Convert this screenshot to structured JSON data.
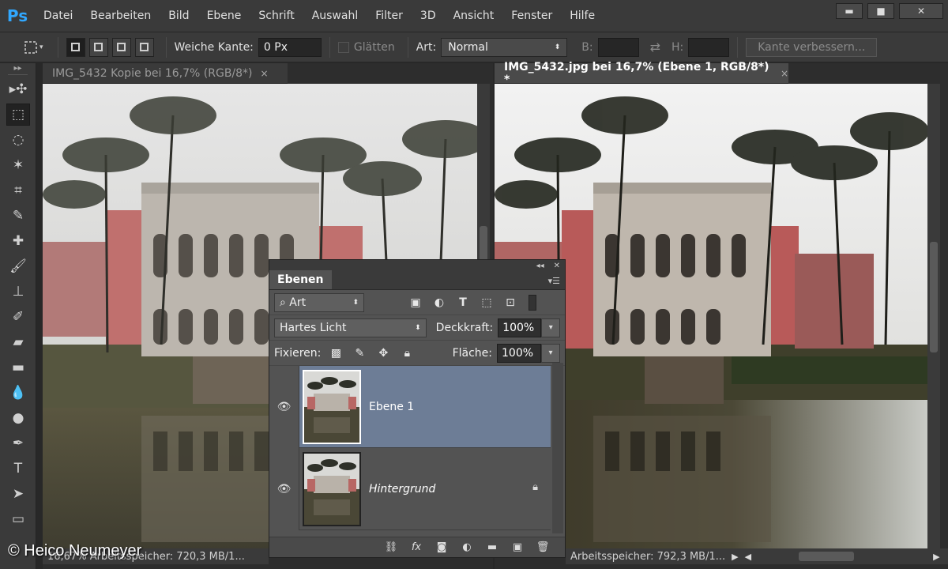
{
  "app": {
    "logo": "Ps"
  },
  "menu": [
    "Datei",
    "Bearbeiten",
    "Bild",
    "Ebene",
    "Schrift",
    "Auswahl",
    "Filter",
    "3D",
    "Ansicht",
    "Fenster",
    "Hilfe"
  ],
  "window_controls": {
    "minimize": "▬",
    "maximize": "■",
    "close": "✕"
  },
  "options": {
    "feather_label": "Weiche Kante:",
    "feather_value": "0 Px",
    "antialias_label": "Glätten",
    "style_label": "Art:",
    "style_value": "Normal",
    "width_label": "B:",
    "height_label": "H:",
    "refine_button": "Kante verbessern..."
  },
  "tools": [
    {
      "name": "move-tool",
      "glyph": "▸✣"
    },
    {
      "name": "marquee-tool",
      "glyph": "⬚"
    },
    {
      "name": "lasso-tool",
      "glyph": "◌"
    },
    {
      "name": "magic-wand-tool",
      "glyph": "✶"
    },
    {
      "name": "crop-tool",
      "glyph": "⌗"
    },
    {
      "name": "eyedropper-tool",
      "glyph": "✎"
    },
    {
      "name": "healing-brush-tool",
      "glyph": "✚"
    },
    {
      "name": "brush-tool",
      "glyph": "🖌"
    },
    {
      "name": "clone-stamp-tool",
      "glyph": "⊥"
    },
    {
      "name": "history-brush-tool",
      "glyph": "✐"
    },
    {
      "name": "eraser-tool",
      "glyph": "▰"
    },
    {
      "name": "gradient-tool",
      "glyph": "▬"
    },
    {
      "name": "blur-tool",
      "glyph": "💧"
    },
    {
      "name": "dodge-tool",
      "glyph": "●"
    },
    {
      "name": "pen-tool",
      "glyph": "✒"
    },
    {
      "name": "type-tool",
      "glyph": "T"
    },
    {
      "name": "path-selection-tool",
      "glyph": "➤"
    },
    {
      "name": "rectangle-tool",
      "glyph": "▭"
    }
  ],
  "documents": {
    "left": {
      "tab": "IMG_5432 Kopie bei 16,7% (RGB/8*)",
      "close": "×",
      "status": "16,67%  Arbeitsspeicher: 720,3 MB/1..."
    },
    "right": {
      "tab": "IMG_5432.jpg bei 16,7% (Ebene 1, RGB/8*) *",
      "close": "×",
      "status": "Arbeitsspeicher: 792,3 MB/1..."
    }
  },
  "layers_panel": {
    "tab": "Ebenen",
    "filter_value": "Art",
    "filter_icon": "⌕",
    "blend_mode": "Hartes Licht",
    "opacity_label": "Deckkraft:",
    "opacity_value": "100%",
    "lock_label": "Fixieren:",
    "fill_label": "Fläche:",
    "fill_value": "100%",
    "layers": [
      {
        "name": "Ebene 1",
        "selected": true,
        "italic": false,
        "locked": false
      },
      {
        "name": "Hintergrund",
        "selected": false,
        "italic": true,
        "locked": true
      }
    ],
    "bottom_icons": [
      "⛓",
      "fx",
      "◙",
      "◐",
      "▬",
      "▣",
      "🗑"
    ]
  },
  "copyright": "© Heico Neumeyer"
}
